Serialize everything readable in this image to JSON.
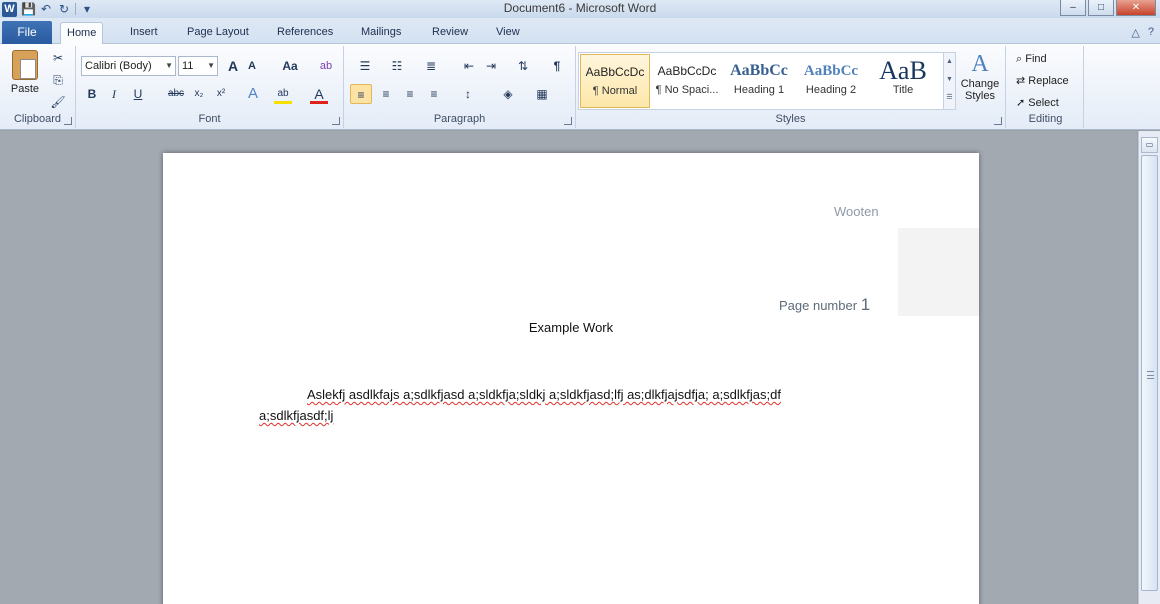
{
  "window": {
    "title": "Document6  -  Microsoft Word",
    "minimize": "–",
    "maximize": "□",
    "close": "✕"
  },
  "quick_access": {
    "app_icon": "W",
    "save": "💾",
    "undo": "↶",
    "redo": "↻",
    "customize": "▾"
  },
  "tabs": {
    "file": "File",
    "items": [
      "Home",
      "Insert",
      "Page Layout",
      "References",
      "Mailings",
      "Review",
      "View"
    ],
    "active": "Home"
  },
  "ribbon": {
    "clipboard": {
      "label": "Clipboard",
      "paste": "Paste"
    },
    "font": {
      "label": "Font",
      "family": "Calibri (Body)",
      "size": "11",
      "grow": "A",
      "shrink": "A",
      "change_case": "Aa",
      "clear": "ab",
      "bold": "B",
      "italic": "I",
      "underline": "U",
      "strike": "abc",
      "subscript": "x₂",
      "superscript": "x²",
      "effects": "A",
      "highlight": "ab",
      "color": "A"
    },
    "paragraph": {
      "label": "Paragraph",
      "pilcrow": "¶"
    },
    "styles": {
      "label": "Styles",
      "items": [
        {
          "sample": "AaBbCcDc",
          "name": "¶ Normal"
        },
        {
          "sample": "AaBbCcDc",
          "name": "¶ No Spaci..."
        },
        {
          "sample": "AaBbCc",
          "name": "Heading 1"
        },
        {
          "sample": "AaBbCc",
          "name": "Heading 2"
        },
        {
          "sample": "AaB",
          "name": "Title"
        }
      ],
      "change_styles_line1": "Change",
      "change_styles_line2": "Styles"
    },
    "editing": {
      "label": "Editing",
      "find": "Find",
      "replace": "Replace",
      "select": "Select"
    }
  },
  "document": {
    "header_name": "Wooten",
    "page_number_label": "Page number",
    "page_number_value": "1",
    "title": "Example Work",
    "line1": "Aslekfj asdlkfajs a;sdlkfjasd a;sldkfja;sldkj  a;sldkfjasd;lfj as;dlkfjajsdfja; a;sdlkfjas;df",
    "line2": "a;sdlkfjasdf;lj"
  },
  "colors": {
    "accent": "#2b5797",
    "spell_underline": "#e0312b",
    "gallery_selected": "#fde7a9"
  }
}
